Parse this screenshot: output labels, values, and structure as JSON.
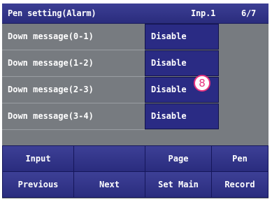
{
  "header": {
    "title": "Pen setting(Alarm)",
    "input": "Inp.1",
    "page": "6/7"
  },
  "rows": [
    {
      "label": "Down message(0-1)",
      "value": "Disable"
    },
    {
      "label": "Down message(1-2)",
      "value": "Disable"
    },
    {
      "label": "Down message(2-3)",
      "value": "Disable"
    },
    {
      "label": "Down message(3-4)",
      "value": "Disable"
    }
  ],
  "buttons": {
    "input": "Input",
    "page": "Page",
    "pen": "Pen",
    "previous": "Previous",
    "next": "Next",
    "set_main": "Set Main",
    "record": "Record"
  },
  "callout": "8",
  "colors": {
    "header": "#2f3188",
    "value_cell": "#2a2b84",
    "background": "#777b80",
    "callout": "#e8327e"
  }
}
